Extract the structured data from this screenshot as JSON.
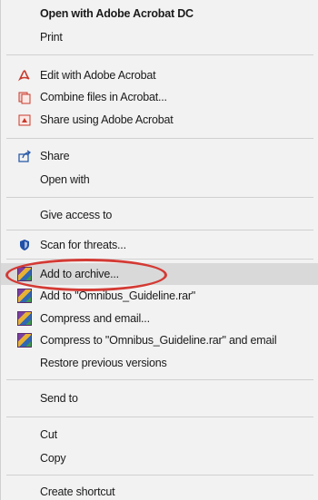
{
  "menu": {
    "items": {
      "open_acrobat": "Open with Adobe Acrobat DC",
      "print": "Print",
      "edit_acrobat": "Edit with Adobe Acrobat",
      "combine_acrobat": "Combine files in Acrobat...",
      "share_acrobat": "Share using Adobe Acrobat",
      "share": "Share",
      "open_with": "Open with",
      "give_access": "Give access to",
      "scan_threats": "Scan for threats...",
      "add_archive": "Add to archive...",
      "add_rar": "Add to \"Omnibus_Guideline.rar\"",
      "compress_email": "Compress and email...",
      "compress_rar_email": "Compress to \"Omnibus_Guideline.rar\" and email",
      "restore_versions": "Restore previous versions",
      "send_to": "Send to",
      "cut": "Cut",
      "copy": "Copy",
      "create_shortcut": "Create shortcut"
    },
    "icons": {
      "acrobat": "acrobat-icon",
      "share": "share-icon",
      "defender": "shield-icon",
      "winrar": "winrar-icon"
    },
    "colors": {
      "highlight": "#d9d9d9",
      "annotation_circle": "#d43a34",
      "acrobat_red": "#c8392b",
      "defender_blue": "#1f4fa8"
    }
  }
}
